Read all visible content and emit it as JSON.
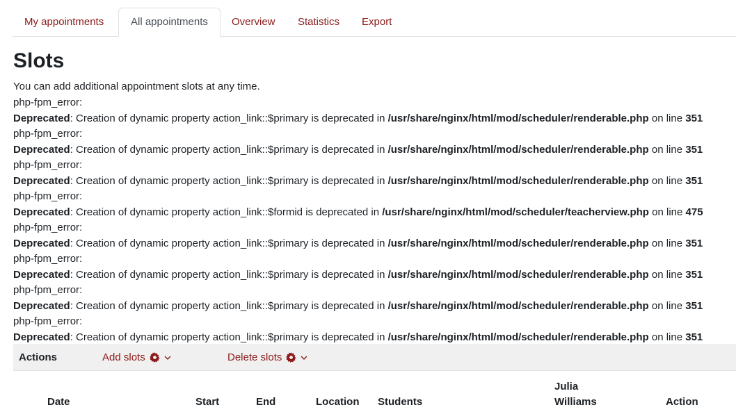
{
  "tabs": [
    {
      "label": "My appointments"
    },
    {
      "label": "All appointments"
    },
    {
      "label": "Overview"
    },
    {
      "label": "Statistics"
    },
    {
      "label": "Export"
    }
  ],
  "page_title": "Slots",
  "intro": "You can add additional appointment slots at any time.",
  "messages": [
    {
      "prefix": "php-fpm_error:",
      "level": "Deprecated",
      "text": ": Creation of dynamic property action_link::$primary is deprecated in ",
      "file": "/usr/share/nginx/html/mod/scheduler/renderable.php",
      "on_line": " on line ",
      "line": "351"
    },
    {
      "prefix": "php-fpm_error:",
      "level": "Deprecated",
      "text": ": Creation of dynamic property action_link::$primary is deprecated in ",
      "file": "/usr/share/nginx/html/mod/scheduler/renderable.php",
      "on_line": " on line ",
      "line": "351"
    },
    {
      "prefix": "php-fpm_error:",
      "level": "Deprecated",
      "text": ": Creation of dynamic property action_link::$primary is deprecated in ",
      "file": "/usr/share/nginx/html/mod/scheduler/renderable.php",
      "on_line": " on line ",
      "line": "351"
    },
    {
      "prefix": "php-fpm_error:",
      "level": "Deprecated",
      "text": ": Creation of dynamic property action_link::$formid is deprecated in ",
      "file": "/usr/share/nginx/html/mod/scheduler/teacherview.php",
      "on_line": " on line ",
      "line": "475"
    },
    {
      "prefix": "php-fpm_error:",
      "level": "Deprecated",
      "text": ": Creation of dynamic property action_link::$primary is deprecated in ",
      "file": "/usr/share/nginx/html/mod/scheduler/renderable.php",
      "on_line": " on line ",
      "line": "351"
    },
    {
      "prefix": "php-fpm_error:",
      "level": "Deprecated",
      "text": ": Creation of dynamic property action_link::$primary is deprecated in ",
      "file": "/usr/share/nginx/html/mod/scheduler/renderable.php",
      "on_line": " on line ",
      "line": "351"
    },
    {
      "prefix": "php-fpm_error:",
      "level": "Deprecated",
      "text": ": Creation of dynamic property action_link::$primary is deprecated in ",
      "file": "/usr/share/nginx/html/mod/scheduler/renderable.php",
      "on_line": " on line ",
      "line": "351"
    },
    {
      "prefix": "php-fpm_error:",
      "level": "Deprecated",
      "text": ": Creation of dynamic property action_link::$primary is deprecated in ",
      "file": "/usr/share/nginx/html/mod/scheduler/renderable.php",
      "on_line": " on line ",
      "line": "351"
    }
  ],
  "actions": {
    "label": "Actions",
    "add_slots": "Add slots",
    "delete_slots": "Delete slots",
    "menu_icon": "gear-icon",
    "caret_icon": "chevron-down-icon"
  },
  "table": {
    "headers": {
      "date": "Date",
      "start": "Start",
      "end": "End",
      "location": "Location",
      "students": "Students",
      "teacher_first": "Julia",
      "teacher_last": "Williams",
      "action": "Action"
    }
  },
  "colors": {
    "link": "#8b1a1a",
    "text": "#1d2125",
    "bar": "#f0f0f0"
  }
}
